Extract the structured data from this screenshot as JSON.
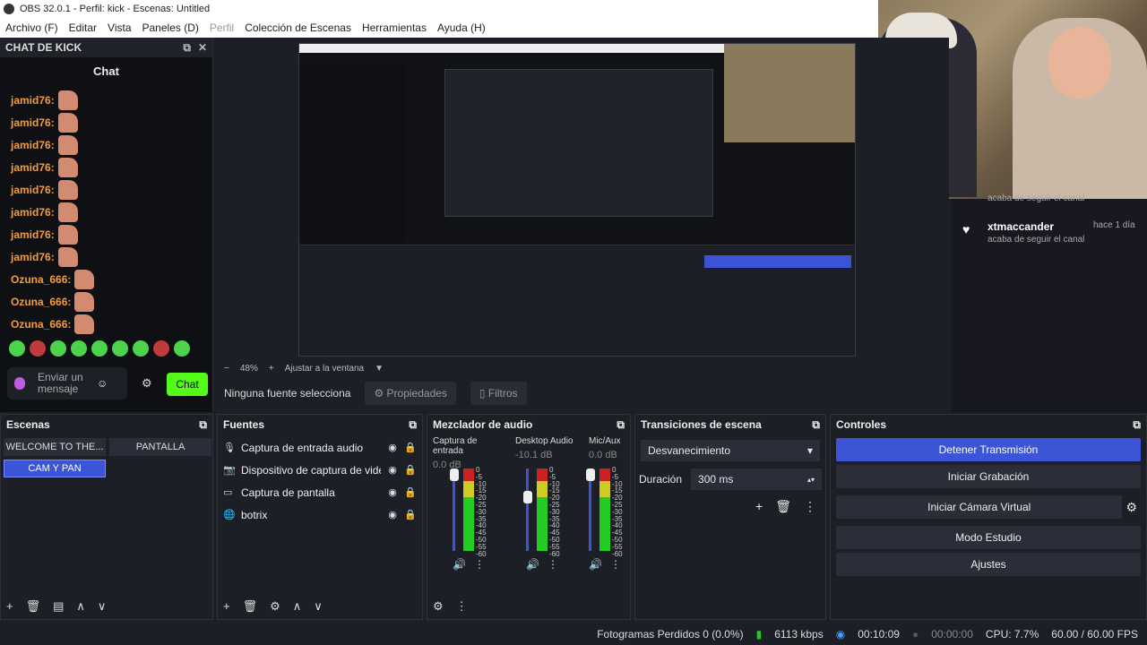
{
  "window": {
    "title": "OBS 32.0.1 - Perfil: kick - Escenas: Untitled"
  },
  "menu": [
    "Archivo (F)",
    "Editar",
    "Vista",
    "Paneles (D)",
    "Perfil",
    "Colección de Escenas",
    "Herramientas",
    "Ayuda (H)"
  ],
  "chat_dock": {
    "title": "CHAT DE KICK",
    "heading": "Chat",
    "messages": [
      {
        "user": "jamid76:"
      },
      {
        "user": "jamid76:"
      },
      {
        "user": "jamid76:"
      },
      {
        "user": "jamid76:"
      },
      {
        "user": "jamid76:"
      },
      {
        "user": "jamid76:"
      },
      {
        "user": "jamid76:"
      },
      {
        "user": "jamid76:"
      },
      {
        "user": "Ozuna_666:"
      },
      {
        "user": "Ozuna_666:"
      },
      {
        "user": "Ozuna_666:"
      }
    ],
    "input_placeholder": "Enviar un mensaje",
    "send_label": "Chat"
  },
  "follow": {
    "cut_text": "acaba de seguir el canal",
    "name": "xtmaccander",
    "time": "hace 1 día",
    "text": "acaba de seguir el canal"
  },
  "preview": {
    "zoom": "48%",
    "fit_label": "Ajustar a la ventana"
  },
  "no_source": {
    "label": "Ninguna fuente selecciona",
    "properties": "Propiedades",
    "filters": "Filtros"
  },
  "scenes": {
    "title": "Escenas",
    "items": [
      "WELCOME TO THE...",
      "PANTALLA",
      "CAM Y PAN"
    ]
  },
  "sources": {
    "title": "Fuentes",
    "items": [
      "Captura de entrada audio",
      "Dispositivo de captura de video",
      "Captura de pantalla",
      "botrix"
    ]
  },
  "mixer": {
    "title": "Mezclador de audio",
    "channels": [
      {
        "name": "Captura de entrada",
        "db": "0.0 dB",
        "level": 0.0
      },
      {
        "name": "Desktop Audio",
        "db": "-10.1 dB",
        "level": 0.83
      },
      {
        "name": "Mic/Aux",
        "db": "0.0 dB",
        "level": 0.0
      }
    ],
    "scale": [
      "0",
      "-5",
      "-10",
      "-15",
      "-20",
      "-25",
      "-30",
      "-35",
      "-40",
      "-45",
      "-50",
      "-55",
      "-60"
    ]
  },
  "transitions": {
    "title": "Transiciones de escena",
    "selected": "Desvanecimiento",
    "duration_label": "Duración",
    "duration_value": "300 ms"
  },
  "controls": {
    "title": "Controles",
    "buttons": [
      "Detener Transmisión",
      "Iniciar Grabación",
      "Iniciar Cámara Virtual",
      "Modo Estudio",
      "Ajustes"
    ]
  },
  "status": {
    "dropped": "Fotogramas Perdidos 0 (0.0%)",
    "bitrate": "6113 kbps",
    "stream_time": "00:10:09",
    "rec_time": "00:00:00",
    "cpu": "CPU: 7.7%",
    "fps": "60.00 / 60.00 FPS"
  }
}
